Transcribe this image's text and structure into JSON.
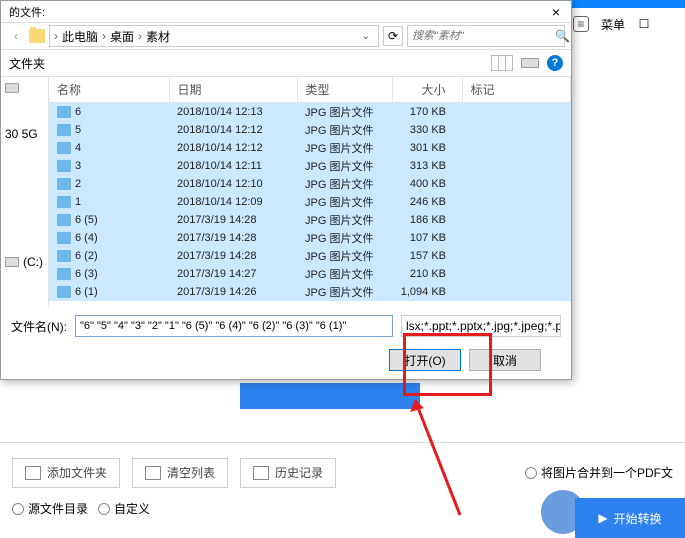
{
  "dialog": {
    "title": "的文件:",
    "close": "×",
    "breadcrumb": [
      "此电脑",
      "桌面",
      "素材"
    ],
    "search_placeholder": "搜索\"素材\"",
    "toolbar_label": "文件夹",
    "columns": [
      "名称",
      "日期",
      "类型",
      "大小",
      "标记"
    ],
    "sidebar": {
      "item1": "30 5G",
      "item2": "(C:)"
    },
    "files": [
      {
        "name": "6",
        "date": "2018/10/14 12:13",
        "type": "JPG 图片文件",
        "size": "170 KB"
      },
      {
        "name": "5",
        "date": "2018/10/14 12:12",
        "type": "JPG 图片文件",
        "size": "330 KB"
      },
      {
        "name": "4",
        "date": "2018/10/14 12:12",
        "type": "JPG 图片文件",
        "size": "301 KB"
      },
      {
        "name": "3",
        "date": "2018/10/14 12:11",
        "type": "JPG 图片文件",
        "size": "313 KB"
      },
      {
        "name": "2",
        "date": "2018/10/14 12:10",
        "type": "JPG 图片文件",
        "size": "400 KB"
      },
      {
        "name": "1",
        "date": "2018/10/14 12:09",
        "type": "JPG 图片文件",
        "size": "246 KB"
      },
      {
        "name": "6 (5)",
        "date": "2017/3/19 14:28",
        "type": "JPG 图片文件",
        "size": "186 KB"
      },
      {
        "name": "6 (4)",
        "date": "2017/3/19 14:28",
        "type": "JPG 图片文件",
        "size": "107 KB"
      },
      {
        "name": "6 (2)",
        "date": "2017/3/19 14:28",
        "type": "JPG 图片文件",
        "size": "157 KB"
      },
      {
        "name": "6 (3)",
        "date": "2017/3/19 14:27",
        "type": "JPG 图片文件",
        "size": "210 KB"
      },
      {
        "name": "6 (1)",
        "date": "2017/3/19 14:26",
        "type": "JPG 图片文件",
        "size": "1,094 KB"
      }
    ],
    "filename_label": "文件名(N):",
    "filename_value": "\"6\" \"5\" \"4\" \"3\" \"2\" \"1\" \"6 (5)\" \"6 (4)\" \"6 (2)\" \"6 (3)\" \"6 (1)\"",
    "filter": "lsx;*.ppt;*.pptx;*.jpg;*.jpeg;*.png;*.bmp;*",
    "open_btn": "打开(O)",
    "cancel_btn": "取消"
  },
  "app": {
    "menu": "菜单",
    "add_folder": "添加文件夹",
    "clear_list": "清空列表",
    "history": "历史记录",
    "merge_pdf": "将图片合并到一个PDF文",
    "src_dir": "源文件目录",
    "custom": "自定义",
    "start": "开始转换"
  }
}
